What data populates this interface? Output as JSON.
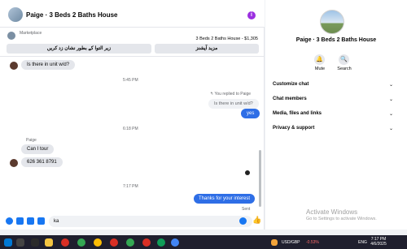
{
  "header": {
    "title": "Paige · 3 Beds 2 Baths House",
    "info_icon": "info-icon"
  },
  "listing": {
    "source": "Marketplace",
    "price_line": "3 Beds 2 Baths House - $1,305",
    "button_left": "زیر التوا کے بطور نشان زد کریں",
    "button_right": "مزید آپشنز"
  },
  "messages": {
    "m1": "Is there in unit w/d?",
    "ts1": "5:45 PM",
    "reply_label": "You replied to Paige",
    "quoted": "Is there in unit w/d?",
    "m2": "yes",
    "ts2": "6:18 PM",
    "sender": "Paige",
    "m3": "Can I tour",
    "m4": "626 361 8791",
    "ts3": "7:17 PM",
    "m5": "Thanks for your interest",
    "sent": "Sent"
  },
  "composer": {
    "value": "ka"
  },
  "panel": {
    "name": "Paige · 3 Beds 2 Baths House",
    "mute": "Mute",
    "search": "Search",
    "sections": [
      "Customize chat",
      "Chat members",
      "Media, files and links",
      "Privacy & support"
    ]
  },
  "watermark": {
    "title": "Activate Windows",
    "sub": "Go to Settings to activate Windows."
  },
  "taskbar": {
    "ticker": "USD/GBP",
    "change": "-0.53%",
    "lang": "ENG",
    "time": "7:17 PM",
    "date": "4/6/2025"
  },
  "colors": {
    "accent": "#2e6ee6",
    "info": "#9b2fe0"
  }
}
